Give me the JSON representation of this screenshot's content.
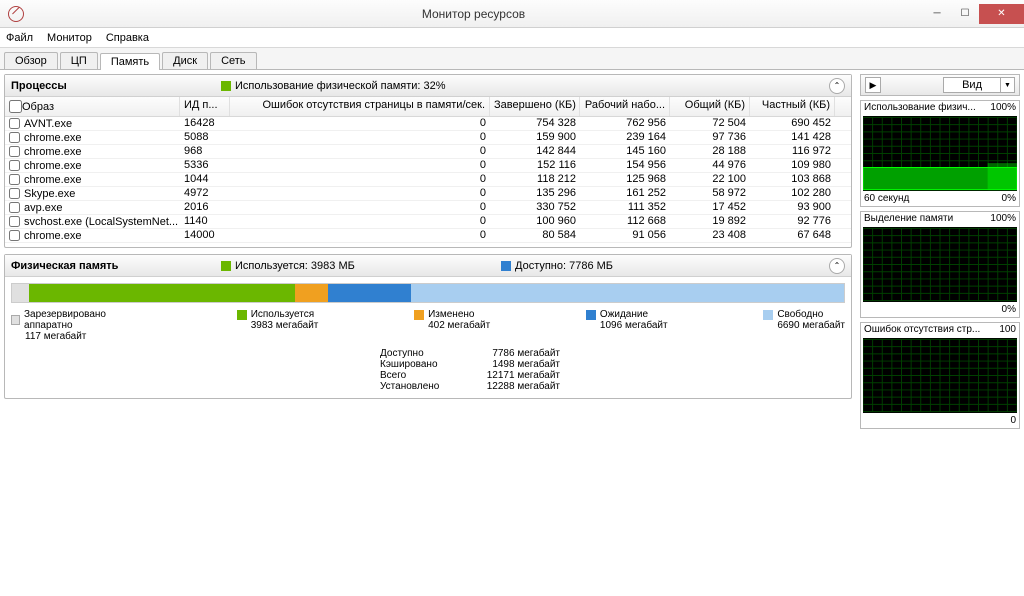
{
  "window": {
    "title": "Монитор ресурсов"
  },
  "menu": [
    "Файл",
    "Монитор",
    "Справка"
  ],
  "tabs": [
    {
      "label": "Обзор",
      "active": false
    },
    {
      "label": "ЦП",
      "active": false
    },
    {
      "label": "Память",
      "active": true
    },
    {
      "label": "Диск",
      "active": false
    },
    {
      "label": "Сеть",
      "active": false
    }
  ],
  "processes_panel": {
    "title": "Процессы",
    "usage_text": "Использование физической памяти: 32%",
    "columns": [
      "Образ",
      "ИД п...",
      "Ошибок отсутствия страницы в памяти/сек.",
      "Завершено (КБ)",
      "Рабочий набо...",
      "Общий (КБ)",
      "Частный (КБ)"
    ],
    "rows": [
      {
        "image": "AVNT.exe",
        "pid": "16428",
        "err": "0",
        "done": "754 328",
        "work": "762 956",
        "shared": "72 504",
        "priv": "690 452"
      },
      {
        "image": "chrome.exe",
        "pid": "5088",
        "err": "0",
        "done": "159 900",
        "work": "239 164",
        "shared": "97 736",
        "priv": "141 428"
      },
      {
        "image": "chrome.exe",
        "pid": "968",
        "err": "0",
        "done": "142 844",
        "work": "145 160",
        "shared": "28 188",
        "priv": "116 972"
      },
      {
        "image": "chrome.exe",
        "pid": "5336",
        "err": "0",
        "done": "152 116",
        "work": "154 956",
        "shared": "44 976",
        "priv": "109 980"
      },
      {
        "image": "chrome.exe",
        "pid": "1044",
        "err": "0",
        "done": "118 212",
        "work": "125 968",
        "shared": "22 100",
        "priv": "103 868"
      },
      {
        "image": "Skype.exe",
        "pid": "4972",
        "err": "0",
        "done": "135 296",
        "work": "161 252",
        "shared": "58 972",
        "priv": "102 280"
      },
      {
        "image": "avp.exe",
        "pid": "2016",
        "err": "0",
        "done": "330 752",
        "work": "111 352",
        "shared": "17 452",
        "priv": "93 900"
      },
      {
        "image": "svchost.exe (LocalSystemNet...",
        "pid": "1140",
        "err": "0",
        "done": "100 960",
        "work": "112 668",
        "shared": "19 892",
        "priv": "92 776"
      },
      {
        "image": "chrome.exe",
        "pid": "14000",
        "err": "0",
        "done": "80 584",
        "work": "91 056",
        "shared": "23 408",
        "priv": "67 648"
      }
    ]
  },
  "physical_panel": {
    "title": "Физическая память",
    "used_text": "Используется: 3983 МБ",
    "avail_text": "Доступно: 7786 МБ",
    "bar": {
      "reserved": {
        "label": "Зарезервировано аппаратно",
        "val": "117 мегабайт",
        "color": "#e0e0e0",
        "pct": 2
      },
      "used": {
        "label": "Используется",
        "val": "3983 мегабайт",
        "color": "#6bb700",
        "pct": 32
      },
      "modified": {
        "label": "Изменено",
        "val": "402 мегабайт",
        "color": "#f0a020",
        "pct": 4
      },
      "standby": {
        "label": "Ожидание",
        "val": "1096 мегабайт",
        "color": "#3080d0",
        "pct": 10
      },
      "free": {
        "label": "Свободно",
        "val": "6690 мегабайт",
        "color": "#a8cef0",
        "pct": 52
      }
    },
    "details": [
      {
        "k": "Доступно",
        "v": "7786 мегабайт"
      },
      {
        "k": "Кэшировано",
        "v": "1498 мегабайт"
      },
      {
        "k": "Всего",
        "v": "12171 мегабайт"
      },
      {
        "k": "Установлено",
        "v": "12288 мегабайт"
      }
    ]
  },
  "side": {
    "view_label": "Вид",
    "graphs": [
      {
        "title": "Использование физич...",
        "top": "100%",
        "foot_l": "60 секунд",
        "foot_r": "0%"
      },
      {
        "title": "Выделение памяти",
        "top": "100%",
        "foot_l": "",
        "foot_r": "0%"
      },
      {
        "title": "Ошибок отсутствия стр...",
        "top": "100",
        "foot_l": "",
        "foot_r": "0"
      }
    ]
  }
}
